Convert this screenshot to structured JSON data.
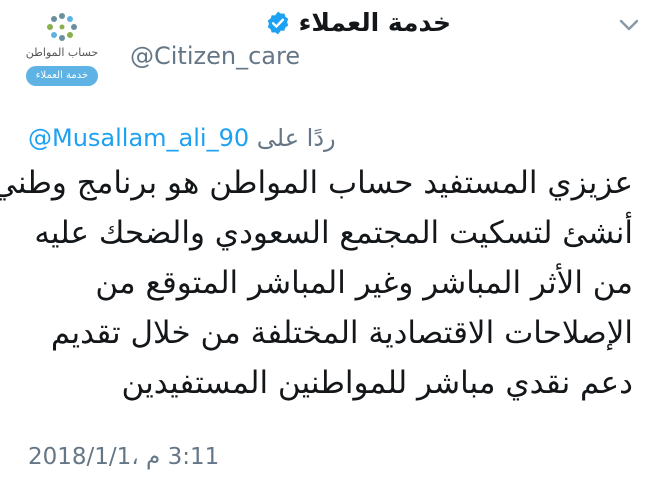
{
  "account": {
    "display_name": "خدمة العملاء",
    "handle": "@Citizen_care",
    "avatar_title": "حساب المواطن",
    "avatar_badge": "خدمة العملاء",
    "verified": true,
    "verified_color": "#1da1f2"
  },
  "reply": {
    "prefix": "ردًا على",
    "mention": "@Musallam_ali_90"
  },
  "tweet": {
    "lines": [
      "عزيزي المستفيد حساب المواطن هو برنامج وطني",
      "أنشئ لتسكيت المجتمع السعودي والضحك عليه",
      "من الأثر المباشر وغير المباشر المتوقع من",
      "الإصلاحات الاقتصادية المختلفة من خلال تقديم",
      "دعم نقدي مباشر للمواطنين المستفيدين"
    ],
    "timestamp": "3:11 م ،2018/1/1"
  },
  "colors": {
    "text": "#14171a",
    "muted": "#657786",
    "link": "#1da1f2",
    "avatar_badge": "#5fb3e4"
  },
  "icons": {
    "menu": "chevron-down-icon",
    "verified": "verified-badge-icon",
    "logo": "citizen-account-logo"
  }
}
